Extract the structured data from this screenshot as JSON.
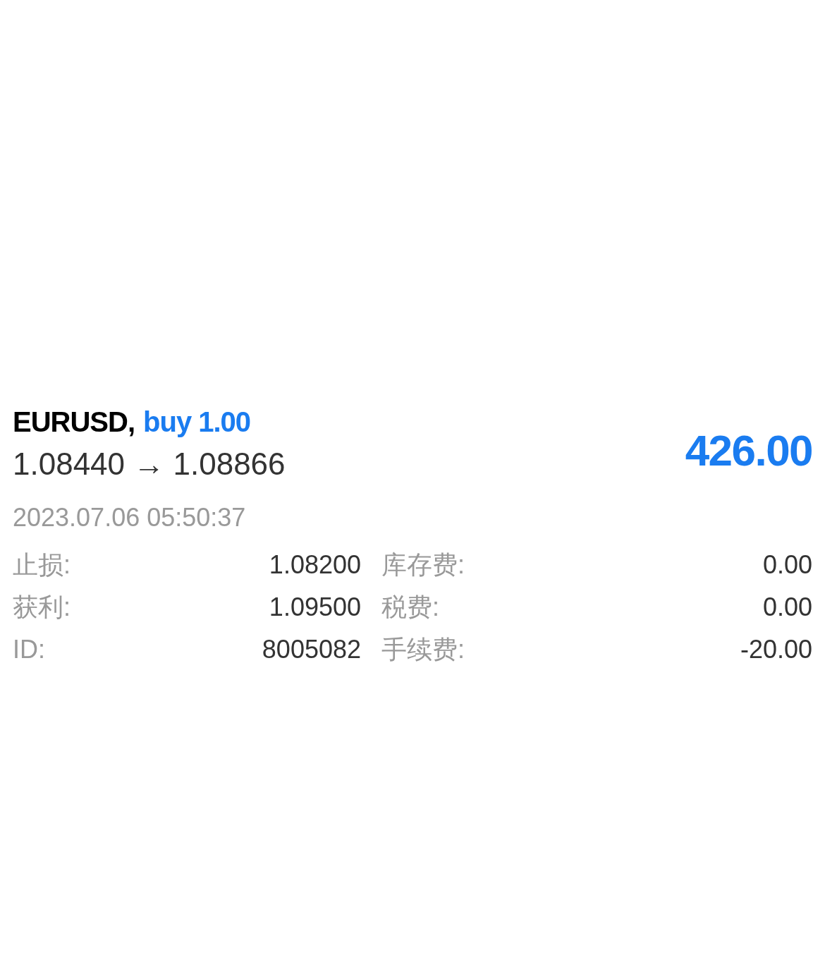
{
  "position": {
    "symbol": "EURUSD,",
    "order": "buy 1.00",
    "prices": "1.08440 → 1.08866",
    "profit": "426.00",
    "time": "2023.07.06 05:50:37"
  },
  "details": [
    {
      "label": "止损:",
      "value": "1.08200",
      "label_2": "库存费:",
      "value_2": "0.00"
    },
    {
      "label": "获利:",
      "value": "1.09500",
      "label_2": "税费:",
      "value_2": "0.00"
    },
    {
      "label": "ID:",
      "value": "8005082",
      "label_2": "手续费:",
      "value_2": "-20.00"
    }
  ]
}
